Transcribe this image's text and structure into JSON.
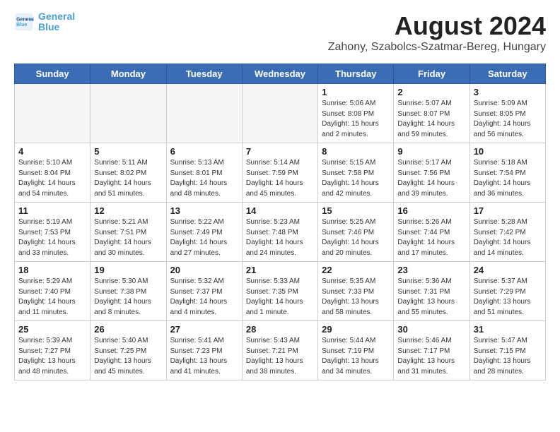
{
  "header": {
    "logo_line1": "General",
    "logo_line2": "Blue",
    "title": "August 2024",
    "subtitle": "Zahony, Szabolcs-Szatmar-Bereg, Hungary"
  },
  "weekdays": [
    "Sunday",
    "Monday",
    "Tuesday",
    "Wednesday",
    "Thursday",
    "Friday",
    "Saturday"
  ],
  "weeks": [
    [
      {
        "day": "",
        "info": ""
      },
      {
        "day": "",
        "info": ""
      },
      {
        "day": "",
        "info": ""
      },
      {
        "day": "",
        "info": ""
      },
      {
        "day": "1",
        "info": "Sunrise: 5:06 AM\nSunset: 8:08 PM\nDaylight: 15 hours\nand 2 minutes."
      },
      {
        "day": "2",
        "info": "Sunrise: 5:07 AM\nSunset: 8:07 PM\nDaylight: 14 hours\nand 59 minutes."
      },
      {
        "day": "3",
        "info": "Sunrise: 5:09 AM\nSunset: 8:05 PM\nDaylight: 14 hours\nand 56 minutes."
      }
    ],
    [
      {
        "day": "4",
        "info": "Sunrise: 5:10 AM\nSunset: 8:04 PM\nDaylight: 14 hours\nand 54 minutes."
      },
      {
        "day": "5",
        "info": "Sunrise: 5:11 AM\nSunset: 8:02 PM\nDaylight: 14 hours\nand 51 minutes."
      },
      {
        "day": "6",
        "info": "Sunrise: 5:13 AM\nSunset: 8:01 PM\nDaylight: 14 hours\nand 48 minutes."
      },
      {
        "day": "7",
        "info": "Sunrise: 5:14 AM\nSunset: 7:59 PM\nDaylight: 14 hours\nand 45 minutes."
      },
      {
        "day": "8",
        "info": "Sunrise: 5:15 AM\nSunset: 7:58 PM\nDaylight: 14 hours\nand 42 minutes."
      },
      {
        "day": "9",
        "info": "Sunrise: 5:17 AM\nSunset: 7:56 PM\nDaylight: 14 hours\nand 39 minutes."
      },
      {
        "day": "10",
        "info": "Sunrise: 5:18 AM\nSunset: 7:54 PM\nDaylight: 14 hours\nand 36 minutes."
      }
    ],
    [
      {
        "day": "11",
        "info": "Sunrise: 5:19 AM\nSunset: 7:53 PM\nDaylight: 14 hours\nand 33 minutes."
      },
      {
        "day": "12",
        "info": "Sunrise: 5:21 AM\nSunset: 7:51 PM\nDaylight: 14 hours\nand 30 minutes."
      },
      {
        "day": "13",
        "info": "Sunrise: 5:22 AM\nSunset: 7:49 PM\nDaylight: 14 hours\nand 27 minutes."
      },
      {
        "day": "14",
        "info": "Sunrise: 5:23 AM\nSunset: 7:48 PM\nDaylight: 14 hours\nand 24 minutes."
      },
      {
        "day": "15",
        "info": "Sunrise: 5:25 AM\nSunset: 7:46 PM\nDaylight: 14 hours\nand 20 minutes."
      },
      {
        "day": "16",
        "info": "Sunrise: 5:26 AM\nSunset: 7:44 PM\nDaylight: 14 hours\nand 17 minutes."
      },
      {
        "day": "17",
        "info": "Sunrise: 5:28 AM\nSunset: 7:42 PM\nDaylight: 14 hours\nand 14 minutes."
      }
    ],
    [
      {
        "day": "18",
        "info": "Sunrise: 5:29 AM\nSunset: 7:40 PM\nDaylight: 14 hours\nand 11 minutes."
      },
      {
        "day": "19",
        "info": "Sunrise: 5:30 AM\nSunset: 7:38 PM\nDaylight: 14 hours\nand 8 minutes."
      },
      {
        "day": "20",
        "info": "Sunrise: 5:32 AM\nSunset: 7:37 PM\nDaylight: 14 hours\nand 4 minutes."
      },
      {
        "day": "21",
        "info": "Sunrise: 5:33 AM\nSunset: 7:35 PM\nDaylight: 14 hours\nand 1 minute."
      },
      {
        "day": "22",
        "info": "Sunrise: 5:35 AM\nSunset: 7:33 PM\nDaylight: 13 hours\nand 58 minutes."
      },
      {
        "day": "23",
        "info": "Sunrise: 5:36 AM\nSunset: 7:31 PM\nDaylight: 13 hours\nand 55 minutes."
      },
      {
        "day": "24",
        "info": "Sunrise: 5:37 AM\nSunset: 7:29 PM\nDaylight: 13 hours\nand 51 minutes."
      }
    ],
    [
      {
        "day": "25",
        "info": "Sunrise: 5:39 AM\nSunset: 7:27 PM\nDaylight: 13 hours\nand 48 minutes."
      },
      {
        "day": "26",
        "info": "Sunrise: 5:40 AM\nSunset: 7:25 PM\nDaylight: 13 hours\nand 45 minutes."
      },
      {
        "day": "27",
        "info": "Sunrise: 5:41 AM\nSunset: 7:23 PM\nDaylight: 13 hours\nand 41 minutes."
      },
      {
        "day": "28",
        "info": "Sunrise: 5:43 AM\nSunset: 7:21 PM\nDaylight: 13 hours\nand 38 minutes."
      },
      {
        "day": "29",
        "info": "Sunrise: 5:44 AM\nSunset: 7:19 PM\nDaylight: 13 hours\nand 34 minutes."
      },
      {
        "day": "30",
        "info": "Sunrise: 5:46 AM\nSunset: 7:17 PM\nDaylight: 13 hours\nand 31 minutes."
      },
      {
        "day": "31",
        "info": "Sunrise: 5:47 AM\nSunset: 7:15 PM\nDaylight: 13 hours\nand 28 minutes."
      }
    ]
  ]
}
